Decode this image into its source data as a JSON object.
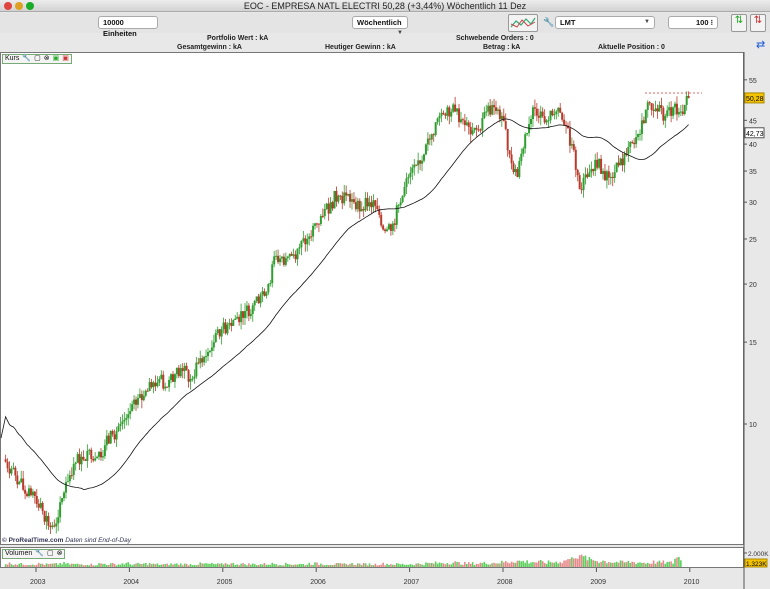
{
  "window": {
    "title": "EOC - EMPRESA NATL ELECTRI    50,28 (+3,44%)   Wöchentlich  11 Dez"
  },
  "toolbar": {
    "units": "10000 Einheiten",
    "period": "Wöchentlich",
    "symbol": "LMT",
    "quantity": "100"
  },
  "info": {
    "portfolio": "Portfolio Wert : kA",
    "gesamtgewinn": "Gesamtgewinn : kA",
    "heutiger": "Heutiger Gewinn : kA",
    "orders": "Schwebende Orders : 0",
    "betrag": "Betrag : kA",
    "position": "Aktuelle Position : 0"
  },
  "panels": {
    "price_label": "Kurs",
    "volume_label": "Volumen",
    "credit_site": "© ProRealTime.com",
    "credit_note": "Daten sind End-of-Day"
  },
  "colors": {
    "up": "#2f9e2f",
    "down": "#b83a2a",
    "vol_up": "#5ccf5c",
    "vol_down": "#e58a8a",
    "last_price_bg": "#f5c400"
  },
  "chart_data": {
    "type": "candlestick",
    "scale": "log",
    "ylim": [
      5,
      60
    ],
    "yticks": [
      10,
      15,
      20,
      25,
      30,
      35,
      40,
      45,
      55
    ],
    "xticks": [
      "2003",
      "2004",
      "2005",
      "2006",
      "2007",
      "2008",
      "2009",
      "2010"
    ],
    "last_price": "50,28",
    "ma_value": "42,73",
    "volume_tick": "2.000K",
    "last_volume": "1.323K",
    "start": "2002-09",
    "monthly_close": [
      8,
      7.5,
      7,
      7,
      6.5,
      6,
      6.3,
      7.5,
      8.2,
      8.5,
      8.8,
      8.5,
      9,
      9.5,
      10,
      10.5,
      11,
      11.5,
      12,
      12.5,
      12,
      12.8,
      13,
      12.5,
      13.5,
      14,
      15,
      16,
      16.5,
      17,
      17.5,
      18,
      19,
      20,
      23,
      22,
      23,
      24,
      25,
      27,
      28,
      30,
      31,
      31,
      30,
      29,
      30,
      29,
      26,
      27,
      30,
      34,
      36,
      38,
      42,
      46,
      48,
      47,
      45,
      42,
      43,
      47,
      48,
      46,
      38,
      34,
      42,
      48,
      47,
      45,
      47,
      44,
      40,
      32,
      34,
      37,
      35,
      34,
      36,
      38,
      40,
      45,
      49,
      47,
      46,
      48,
      47,
      50.28
    ],
    "monthly_volume_k": [
      500,
      450,
      400,
      420,
      450,
      380,
      400,
      500,
      420,
      380,
      400,
      350,
      450,
      420,
      380,
      500,
      400,
      420,
      450,
      380,
      350,
      400,
      420,
      380,
      400,
      450,
      420,
      380,
      500,
      450,
      420,
      400,
      380,
      420,
      450,
      400,
      420,
      400,
      380,
      500,
      450,
      420,
      400,
      380,
      450,
      420,
      400,
      380,
      450,
      420,
      400,
      380,
      420,
      450,
      500,
      550,
      600,
      650,
      550,
      500,
      500,
      550,
      600,
      650,
      700,
      900,
      800,
      750,
      700,
      650,
      700,
      800,
      1100,
      1800,
      1300,
      1000,
      900,
      800,
      700,
      650,
      700,
      650,
      600,
      700,
      650,
      600,
      1323
    ]
  }
}
